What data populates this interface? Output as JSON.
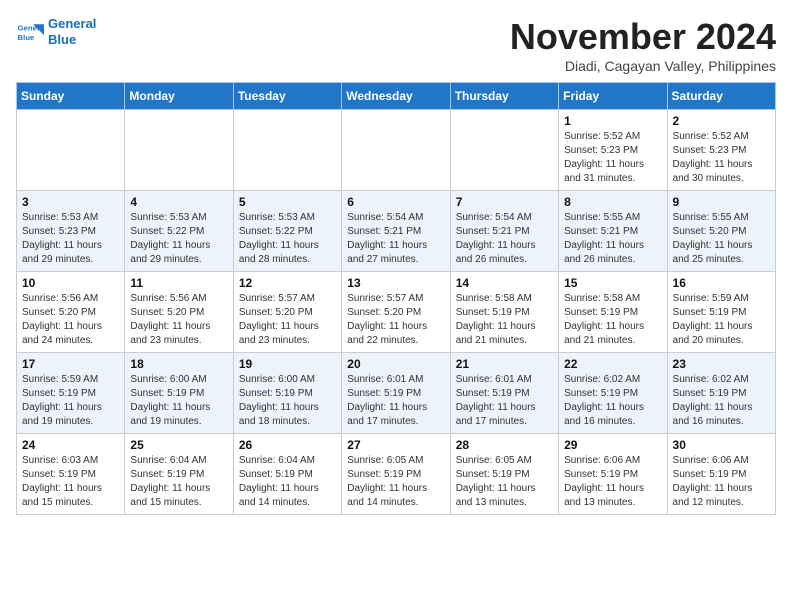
{
  "header": {
    "logo_line1": "General",
    "logo_line2": "Blue",
    "month": "November 2024",
    "location": "Diadi, Cagayan Valley, Philippines"
  },
  "weekdays": [
    "Sunday",
    "Monday",
    "Tuesday",
    "Wednesday",
    "Thursday",
    "Friday",
    "Saturday"
  ],
  "weeks": [
    [
      {
        "day": "",
        "info": ""
      },
      {
        "day": "",
        "info": ""
      },
      {
        "day": "",
        "info": ""
      },
      {
        "day": "",
        "info": ""
      },
      {
        "day": "",
        "info": ""
      },
      {
        "day": "1",
        "info": "Sunrise: 5:52 AM\nSunset: 5:23 PM\nDaylight: 11 hours\nand 31 minutes."
      },
      {
        "day": "2",
        "info": "Sunrise: 5:52 AM\nSunset: 5:23 PM\nDaylight: 11 hours\nand 30 minutes."
      }
    ],
    [
      {
        "day": "3",
        "info": "Sunrise: 5:53 AM\nSunset: 5:23 PM\nDaylight: 11 hours\nand 29 minutes."
      },
      {
        "day": "4",
        "info": "Sunrise: 5:53 AM\nSunset: 5:22 PM\nDaylight: 11 hours\nand 29 minutes."
      },
      {
        "day": "5",
        "info": "Sunrise: 5:53 AM\nSunset: 5:22 PM\nDaylight: 11 hours\nand 28 minutes."
      },
      {
        "day": "6",
        "info": "Sunrise: 5:54 AM\nSunset: 5:21 PM\nDaylight: 11 hours\nand 27 minutes."
      },
      {
        "day": "7",
        "info": "Sunrise: 5:54 AM\nSunset: 5:21 PM\nDaylight: 11 hours\nand 26 minutes."
      },
      {
        "day": "8",
        "info": "Sunrise: 5:55 AM\nSunset: 5:21 PM\nDaylight: 11 hours\nand 26 minutes."
      },
      {
        "day": "9",
        "info": "Sunrise: 5:55 AM\nSunset: 5:20 PM\nDaylight: 11 hours\nand 25 minutes."
      }
    ],
    [
      {
        "day": "10",
        "info": "Sunrise: 5:56 AM\nSunset: 5:20 PM\nDaylight: 11 hours\nand 24 minutes."
      },
      {
        "day": "11",
        "info": "Sunrise: 5:56 AM\nSunset: 5:20 PM\nDaylight: 11 hours\nand 23 minutes."
      },
      {
        "day": "12",
        "info": "Sunrise: 5:57 AM\nSunset: 5:20 PM\nDaylight: 11 hours\nand 23 minutes."
      },
      {
        "day": "13",
        "info": "Sunrise: 5:57 AM\nSunset: 5:20 PM\nDaylight: 11 hours\nand 22 minutes."
      },
      {
        "day": "14",
        "info": "Sunrise: 5:58 AM\nSunset: 5:19 PM\nDaylight: 11 hours\nand 21 minutes."
      },
      {
        "day": "15",
        "info": "Sunrise: 5:58 AM\nSunset: 5:19 PM\nDaylight: 11 hours\nand 21 minutes."
      },
      {
        "day": "16",
        "info": "Sunrise: 5:59 AM\nSunset: 5:19 PM\nDaylight: 11 hours\nand 20 minutes."
      }
    ],
    [
      {
        "day": "17",
        "info": "Sunrise: 5:59 AM\nSunset: 5:19 PM\nDaylight: 11 hours\nand 19 minutes."
      },
      {
        "day": "18",
        "info": "Sunrise: 6:00 AM\nSunset: 5:19 PM\nDaylight: 11 hours\nand 19 minutes."
      },
      {
        "day": "19",
        "info": "Sunrise: 6:00 AM\nSunset: 5:19 PM\nDaylight: 11 hours\nand 18 minutes."
      },
      {
        "day": "20",
        "info": "Sunrise: 6:01 AM\nSunset: 5:19 PM\nDaylight: 11 hours\nand 17 minutes."
      },
      {
        "day": "21",
        "info": "Sunrise: 6:01 AM\nSunset: 5:19 PM\nDaylight: 11 hours\nand 17 minutes."
      },
      {
        "day": "22",
        "info": "Sunrise: 6:02 AM\nSunset: 5:19 PM\nDaylight: 11 hours\nand 16 minutes."
      },
      {
        "day": "23",
        "info": "Sunrise: 6:02 AM\nSunset: 5:19 PM\nDaylight: 11 hours\nand 16 minutes."
      }
    ],
    [
      {
        "day": "24",
        "info": "Sunrise: 6:03 AM\nSunset: 5:19 PM\nDaylight: 11 hours\nand 15 minutes."
      },
      {
        "day": "25",
        "info": "Sunrise: 6:04 AM\nSunset: 5:19 PM\nDaylight: 11 hours\nand 15 minutes."
      },
      {
        "day": "26",
        "info": "Sunrise: 6:04 AM\nSunset: 5:19 PM\nDaylight: 11 hours\nand 14 minutes."
      },
      {
        "day": "27",
        "info": "Sunrise: 6:05 AM\nSunset: 5:19 PM\nDaylight: 11 hours\nand 14 minutes."
      },
      {
        "day": "28",
        "info": "Sunrise: 6:05 AM\nSunset: 5:19 PM\nDaylight: 11 hours\nand 13 minutes."
      },
      {
        "day": "29",
        "info": "Sunrise: 6:06 AM\nSunset: 5:19 PM\nDaylight: 11 hours\nand 13 minutes."
      },
      {
        "day": "30",
        "info": "Sunrise: 6:06 AM\nSunset: 5:19 PM\nDaylight: 11 hours\nand 12 minutes."
      }
    ]
  ]
}
